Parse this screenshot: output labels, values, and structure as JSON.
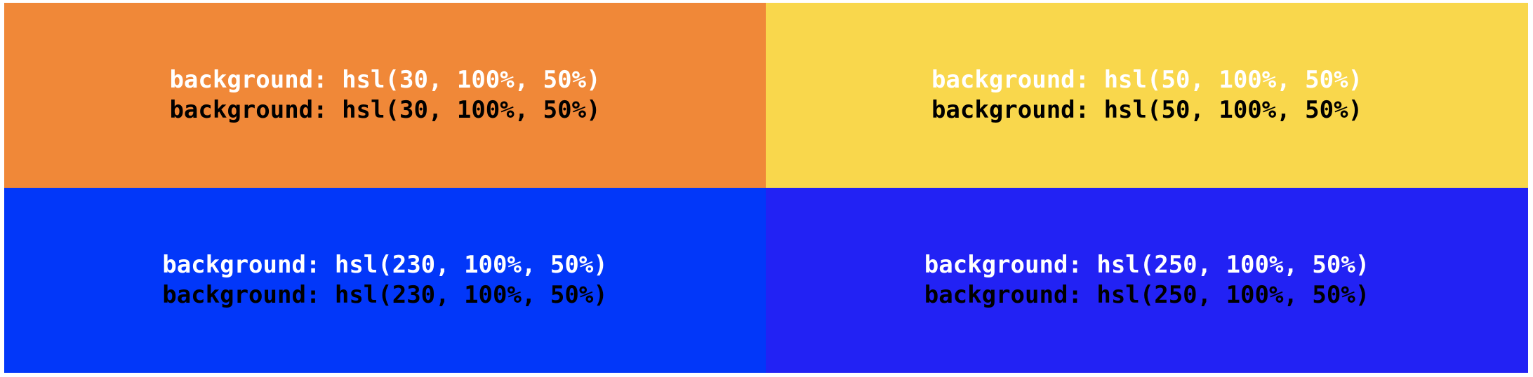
{
  "tiles": [
    {
      "name": "tile-hsl-30",
      "background": "#f08838",
      "white_text": "background: hsl(30, 100%, 50%)",
      "black_text": "background: hsl(30, 100%, 50%)"
    },
    {
      "name": "tile-hsl-50",
      "background": "#f9d74c",
      "white_text": "background: hsl(50, 100%, 50%)",
      "black_text": "background: hsl(50, 100%, 50%)"
    },
    {
      "name": "tile-hsl-230",
      "background": "#0237f9",
      "white_text": "background: hsl(230, 100%, 50%)",
      "black_text": "background: hsl(230, 100%, 50%)"
    },
    {
      "name": "tile-hsl-250",
      "background": "#2222f4",
      "white_text": "background: hsl(250, 100%, 50%)",
      "black_text": "background: hsl(250, 100%, 50%)"
    }
  ]
}
